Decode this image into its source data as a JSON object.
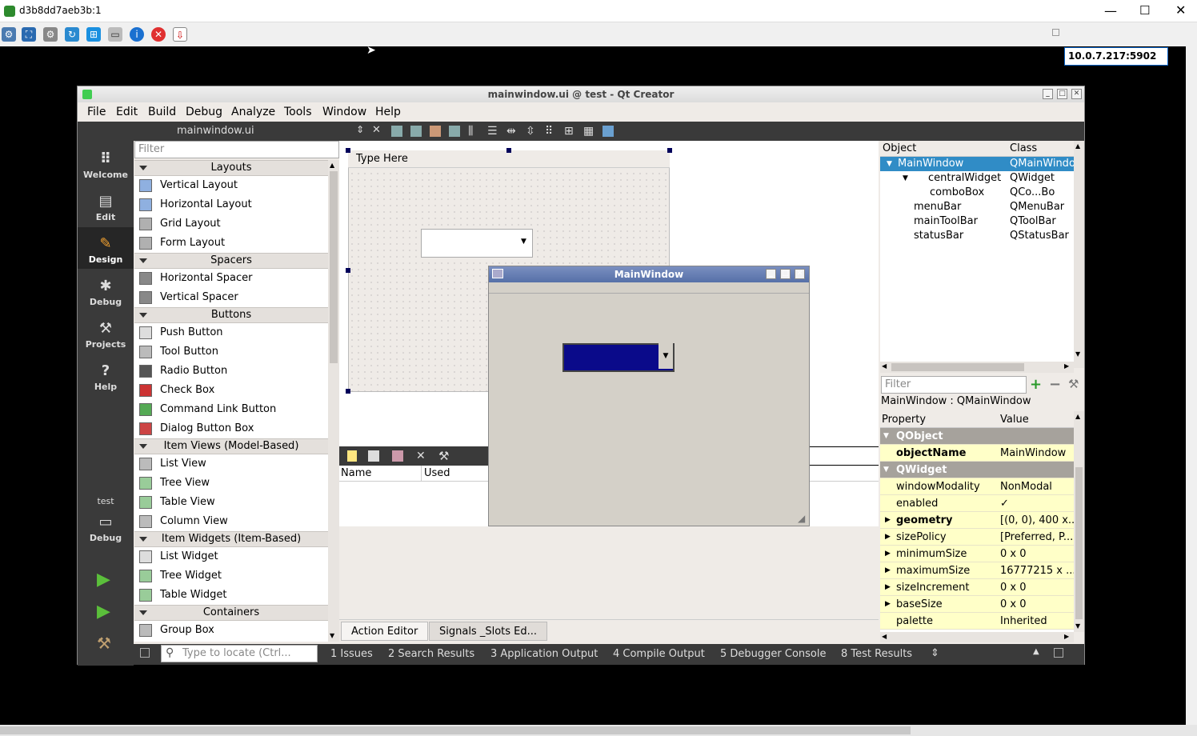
{
  "vnc": {
    "title": "d3b8dd7aeb3b:1",
    "address": "10.0.7.217:5902"
  },
  "qt": {
    "title": "mainwindow.ui @ test - Qt Creator",
    "menu": [
      "File",
      "Edit",
      "Build",
      "Debug",
      "Analyze",
      "Tools",
      "Window",
      "Help"
    ],
    "open_file": "mainwindow.ui",
    "modes": [
      "Welcome",
      "Edit",
      "Design",
      "Debug",
      "Projects",
      "Help"
    ],
    "active_mode": "Design",
    "kit_label": "test",
    "kit_mode": "Debug",
    "filter_placeholder": "Filter",
    "widgetbox": [
      {
        "type": "cat",
        "label": "Layouts"
      },
      {
        "type": "item",
        "label": "Vertical Layout"
      },
      {
        "type": "item",
        "label": "Horizontal Layout"
      },
      {
        "type": "item",
        "label": "Grid Layout"
      },
      {
        "type": "item",
        "label": "Form Layout"
      },
      {
        "type": "cat",
        "label": "Spacers"
      },
      {
        "type": "item",
        "label": "Horizontal Spacer"
      },
      {
        "type": "item",
        "label": "Vertical Spacer"
      },
      {
        "type": "cat",
        "label": "Buttons"
      },
      {
        "type": "item",
        "label": "Push Button"
      },
      {
        "type": "item",
        "label": "Tool Button"
      },
      {
        "type": "item",
        "label": "Radio Button"
      },
      {
        "type": "item",
        "label": "Check Box"
      },
      {
        "type": "item",
        "label": "Command Link Button"
      },
      {
        "type": "item",
        "label": "Dialog Button Box"
      },
      {
        "type": "cat",
        "label": "Item Views (Model-Based)"
      },
      {
        "type": "item",
        "label": "List View"
      },
      {
        "type": "item",
        "label": "Tree View"
      },
      {
        "type": "item",
        "label": "Table View"
      },
      {
        "type": "item",
        "label": "Column View"
      },
      {
        "type": "cat",
        "label": "Item Widgets (Item-Based)"
      },
      {
        "type": "item",
        "label": "List Widget"
      },
      {
        "type": "item",
        "label": "Tree Widget"
      },
      {
        "type": "item",
        "label": "Table Widget"
      },
      {
        "type": "cat",
        "label": "Containers"
      },
      {
        "type": "item",
        "label": "Group Box"
      }
    ],
    "form": {
      "menu_placeholder": "Type Here"
    },
    "preview": {
      "title": "MainWindow"
    },
    "action_editor": {
      "col_name": "Name",
      "col_used": "Used"
    },
    "bottom_tabs": [
      "Action Editor",
      "Signals _Slots Ed..."
    ],
    "object_inspector": {
      "col_object": "Object",
      "col_class": "Class",
      "rows": [
        {
          "obj": "MainWindow",
          "cls": "QMainWindo",
          "indent": 0,
          "selected": true,
          "expander": true
        },
        {
          "obj": "centralWidget",
          "cls": "QWidget",
          "indent": 1,
          "selected": false,
          "expander": true
        },
        {
          "obj": "comboBox",
          "cls": "QCo...Bo",
          "indent": 2,
          "selected": false,
          "expander": false
        },
        {
          "obj": "menuBar",
          "cls": "QMenuBar",
          "indent": 1,
          "selected": false,
          "expander": false
        },
        {
          "obj": "mainToolBar",
          "cls": "QToolBar",
          "indent": 1,
          "selected": false,
          "expander": false
        },
        {
          "obj": "statusBar",
          "cls": "QStatusBar",
          "indent": 1,
          "selected": false,
          "expander": false
        }
      ]
    },
    "property_editor": {
      "filter_placeholder": "Filter",
      "class_label": "MainWindow : QMainWindow",
      "col_property": "Property",
      "col_value": "Value",
      "rows": [
        {
          "k": "QObject",
          "v": "",
          "kind": "grp"
        },
        {
          "k": "objectName",
          "v": "MainWindow",
          "kind": "bold"
        },
        {
          "k": "QWidget",
          "v": "",
          "kind": "grp"
        },
        {
          "k": "windowModality",
          "v": "NonModal",
          "kind": "yel"
        },
        {
          "k": "enabled",
          "v": "✓",
          "kind": "yel"
        },
        {
          "k": "geometry",
          "v": "[(0, 0), 400 x...",
          "kind": "yelbold"
        },
        {
          "k": "sizePolicy",
          "v": "[Preferred, P...",
          "kind": "yel"
        },
        {
          "k": "minimumSize",
          "v": "0 x 0",
          "kind": "yel"
        },
        {
          "k": "maximumSize",
          "v": "16777215 x ...",
          "kind": "yel"
        },
        {
          "k": "sizeIncrement",
          "v": "0 x 0",
          "kind": "yel"
        },
        {
          "k": "baseSize",
          "v": "0 x 0",
          "kind": "yel"
        },
        {
          "k": "palette",
          "v": "Inherited",
          "kind": "yel"
        }
      ]
    },
    "statusbar": {
      "locate_placeholder": "Type to locate (Ctrl...",
      "panes": [
        "1  Issues",
        "2  Search Results",
        "3  Application Output",
        "4  Compile Output",
        "5  Debugger Console",
        "8  Test Results"
      ]
    }
  }
}
